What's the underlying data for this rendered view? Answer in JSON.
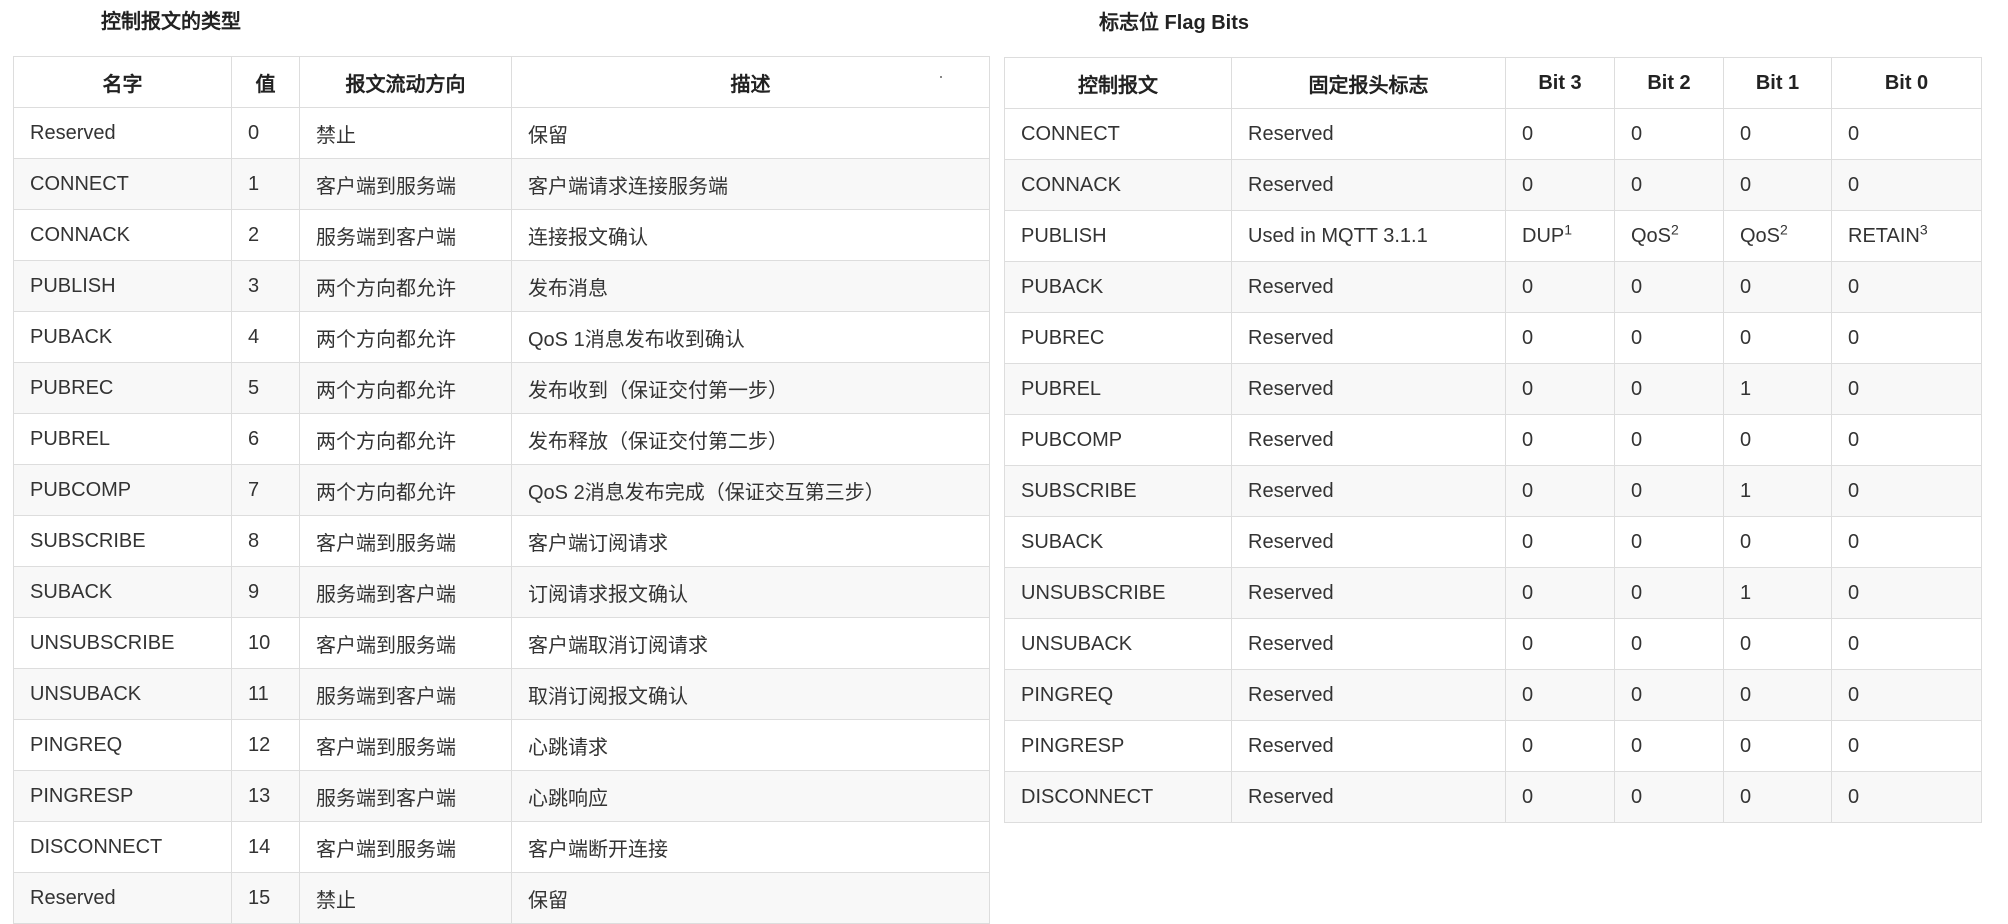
{
  "types_section": {
    "title": "控制报文的类型",
    "columns": [
      "名字",
      "值",
      "报文流动方向",
      "描述"
    ],
    "rows": [
      {
        "name": "Reserved",
        "value": "0",
        "direction": "禁止",
        "desc": "保留"
      },
      {
        "name": "CONNECT",
        "value": "1",
        "direction": "客户端到服务端",
        "desc": "客户端请求连接服务端"
      },
      {
        "name": "CONNACK",
        "value": "2",
        "direction": "服务端到客户端",
        "desc": "连接报文确认"
      },
      {
        "name": "PUBLISH",
        "value": "3",
        "direction": "两个方向都允许",
        "desc": "发布消息"
      },
      {
        "name": "PUBACK",
        "value": "4",
        "direction": "两个方向都允许",
        "desc": "QoS 1消息发布收到确认"
      },
      {
        "name": "PUBREC",
        "value": "5",
        "direction": "两个方向都允许",
        "desc": "发布收到（保证交付第一步）"
      },
      {
        "name": "PUBREL",
        "value": "6",
        "direction": "两个方向都允许",
        "desc": "发布释放（保证交付第二步）"
      },
      {
        "name": "PUBCOMP",
        "value": "7",
        "direction": "两个方向都允许",
        "desc": "QoS 2消息发布完成（保证交互第三步）"
      },
      {
        "name": "SUBSCRIBE",
        "value": "8",
        "direction": "客户端到服务端",
        "desc": "客户端订阅请求"
      },
      {
        "name": "SUBACK",
        "value": "9",
        "direction": "服务端到客户端",
        "desc": "订阅请求报文确认"
      },
      {
        "name": "UNSUBSCRIBE",
        "value": "10",
        "direction": "客户端到服务端",
        "desc": "客户端取消订阅请求"
      },
      {
        "name": "UNSUBACK",
        "value": "11",
        "direction": "服务端到客户端",
        "desc": "取消订阅报文确认"
      },
      {
        "name": "PINGREQ",
        "value": "12",
        "direction": "客户端到服务端",
        "desc": "心跳请求"
      },
      {
        "name": "PINGRESP",
        "value": "13",
        "direction": "服务端到客户端",
        "desc": "心跳响应"
      },
      {
        "name": "DISCONNECT",
        "value": "14",
        "direction": "客户端到服务端",
        "desc": "客户端断开连接"
      },
      {
        "name": "Reserved",
        "value": "15",
        "direction": "禁止",
        "desc": "保留"
      }
    ]
  },
  "flags_section": {
    "title": "标志位 Flag Bits",
    "columns": [
      "控制报文",
      "固定报头标志",
      "Bit 3",
      "Bit 2",
      "Bit 1",
      "Bit 0"
    ],
    "rows": [
      {
        "packet": "CONNECT",
        "flags": "Reserved",
        "b3": "0",
        "b2": "0",
        "b1": "0",
        "b0": "0"
      },
      {
        "packet": "CONNACK",
        "flags": "Reserved",
        "b3": "0",
        "b2": "0",
        "b1": "0",
        "b0": "0"
      },
      {
        "packet": "PUBLISH",
        "flags": "Used in MQTT 3.1.1",
        "b3": "DUP",
        "b3_sup": "1",
        "b2": "QoS",
        "b2_sup": "2",
        "b1": "QoS",
        "b1_sup": "2",
        "b0": "RETAIN",
        "b0_sup": "3"
      },
      {
        "packet": "PUBACK",
        "flags": "Reserved",
        "b3": "0",
        "b2": "0",
        "b1": "0",
        "b0": "0"
      },
      {
        "packet": "PUBREC",
        "flags": "Reserved",
        "b3": "0",
        "b2": "0",
        "b1": "0",
        "b0": "0"
      },
      {
        "packet": "PUBREL",
        "flags": "Reserved",
        "b3": "0",
        "b2": "0",
        "b1": "1",
        "b0": "0"
      },
      {
        "packet": "PUBCOMP",
        "flags": "Reserved",
        "b3": "0",
        "b2": "0",
        "b1": "0",
        "b0": "0"
      },
      {
        "packet": "SUBSCRIBE",
        "flags": "Reserved",
        "b3": "0",
        "b2": "0",
        "b1": "1",
        "b0": "0"
      },
      {
        "packet": "SUBACK",
        "flags": "Reserved",
        "b3": "0",
        "b2": "0",
        "b1": "0",
        "b0": "0"
      },
      {
        "packet": "UNSUBSCRIBE",
        "flags": "Reserved",
        "b3": "0",
        "b2": "0",
        "b1": "1",
        "b0": "0"
      },
      {
        "packet": "UNSUBACK",
        "flags": "Reserved",
        "b3": "0",
        "b2": "0",
        "b1": "0",
        "b0": "0"
      },
      {
        "packet": "PINGREQ",
        "flags": "Reserved",
        "b3": "0",
        "b2": "0",
        "b1": "0",
        "b0": "0"
      },
      {
        "packet": "PINGRESP",
        "flags": "Reserved",
        "b3": "0",
        "b2": "0",
        "b1": "0",
        "b0": "0"
      },
      {
        "packet": "DISCONNECT",
        "flags": "Reserved",
        "b3": "0",
        "b2": "0",
        "b1": "0",
        "b0": "0"
      }
    ]
  }
}
